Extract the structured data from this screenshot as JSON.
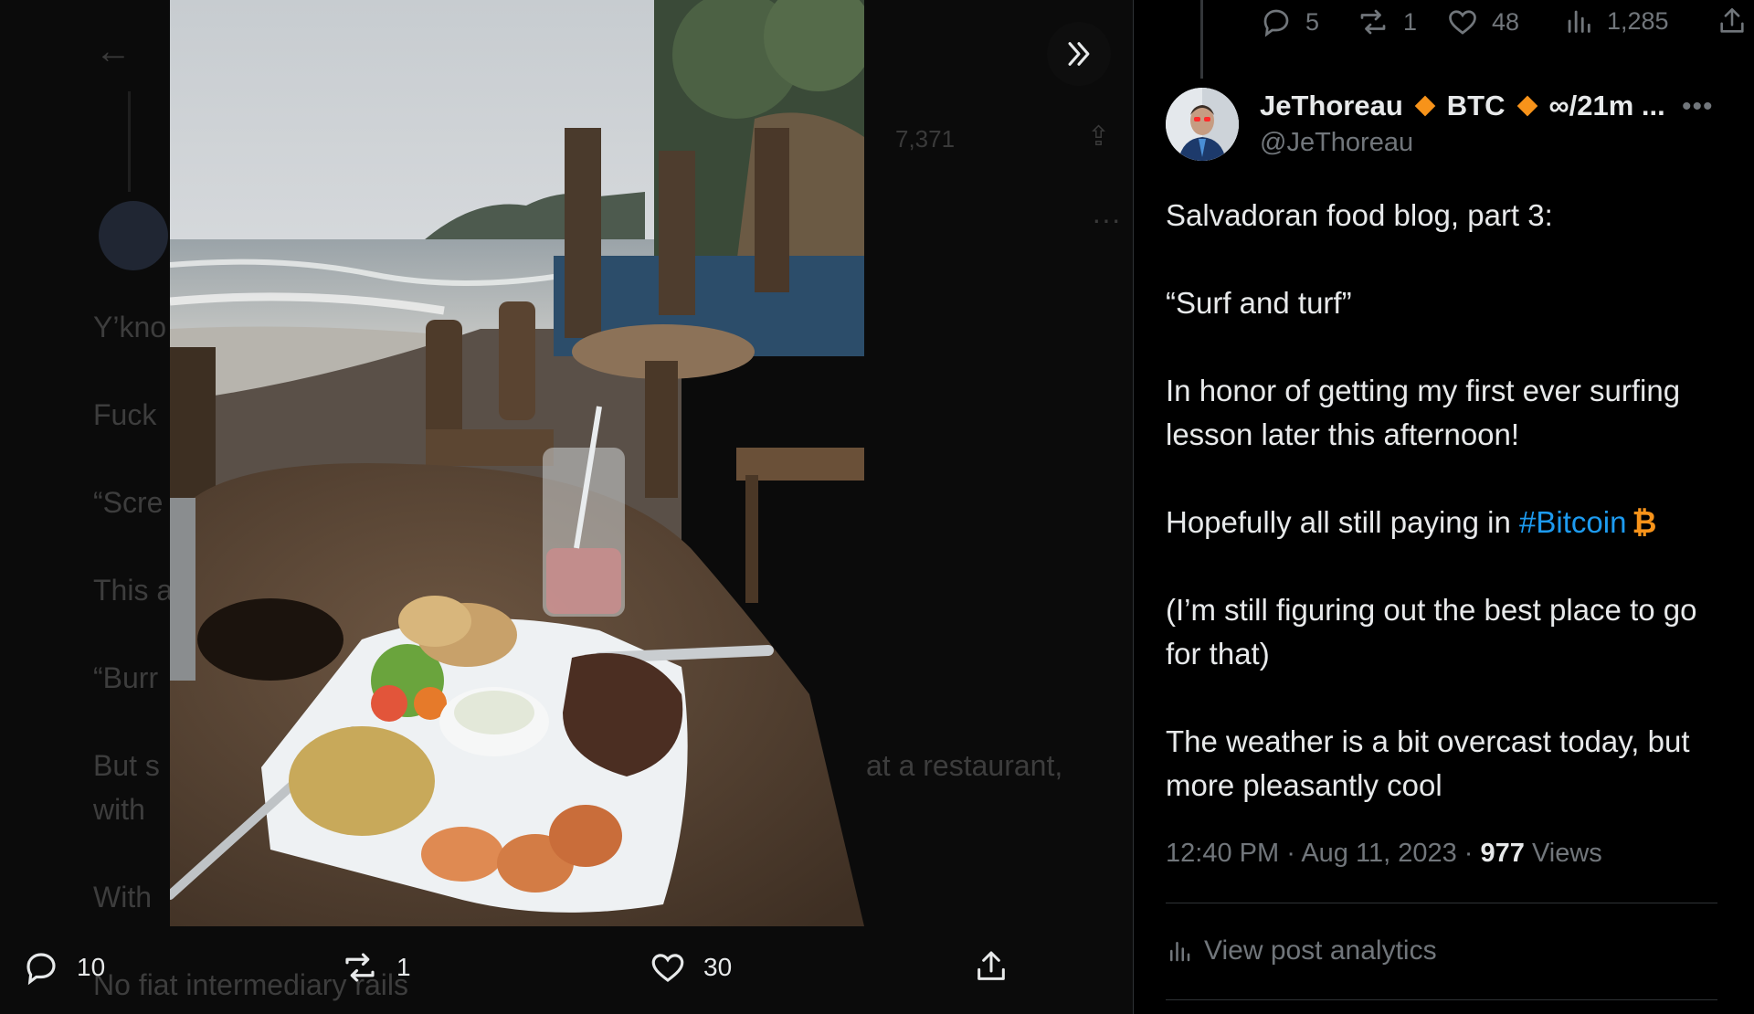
{
  "background_thread": {
    "views": "7,371",
    "lines": [
      "Y’kno",
      "Fuck",
      "“Scre",
      "This a",
      "“Burr",
      "But s",
      "with",
      "With",
      "No fiat intermediary rails"
    ],
    "right_fragment": "at a restaurant,"
  },
  "media_actions": {
    "replies": "10",
    "reposts": "1",
    "likes": "30"
  },
  "top_actions": {
    "replies": "5",
    "reposts": "1",
    "likes": "48",
    "views": "1,285"
  },
  "author": {
    "display_name": "JeThoreau",
    "tag1": "BTC",
    "tag2": "∞/21m ...",
    "handle": "@JeThoreau"
  },
  "tweet": {
    "p1": "Salvadoran food blog, part 3:",
    "p2": "“Surf and turf”",
    "p3": "In honor of getting my first ever surfing lesson later this afternoon!",
    "p4_prefix": "Hopefully all still paying in ",
    "hashtag": "#Bitcoin",
    "btc_symbol": "₿",
    "p5": "(I’m still figuring out the best place to go for that)",
    "p6": "The weather is a bit overcast today, but more pleasantly cool"
  },
  "meta": {
    "time": "12:40 PM",
    "date": "Aug 11, 2023",
    "views_count": "977",
    "views_label": "Views"
  },
  "analytics_label": "View post analytics",
  "colors": {
    "accent": "#1d9bf0",
    "bitcoin": "#f7931a",
    "muted": "#71767b"
  }
}
